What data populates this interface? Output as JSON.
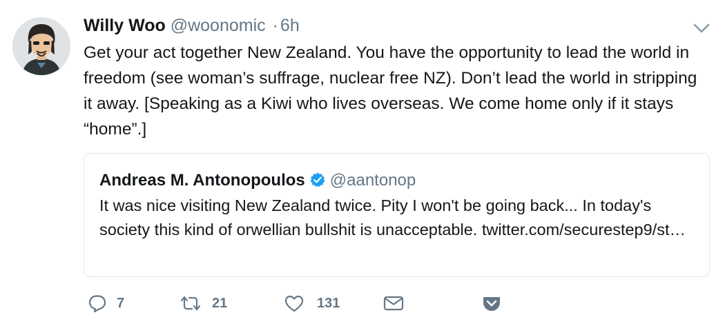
{
  "tweet": {
    "author_name": "Willy Woo",
    "author_handle": "@woonomic",
    "separator": "·",
    "time": "6h",
    "text": "Get your act together New Zealand. You have the opportunity to lead the world in freedom (see woman’s suffrage, nuclear free NZ). Don’t lead the world in stripping it away. [Speaking as a Kiwi who lives overseas. We come home only if it stays “home”.]"
  },
  "quoted_tweet": {
    "author_name": "Andreas M. Antonopoulos",
    "author_handle": "@aantonop",
    "verified": true,
    "text": "It was nice visiting New Zealand twice. Pity I won't be going back... In today's society this kind of orwellian bullshit is unacceptable. twitter.com/securestep9/st…"
  },
  "actions": {
    "reply_count": "7",
    "retweet_count": "21",
    "like_count": "131"
  },
  "colors": {
    "text": "#14171a",
    "secondary": "#657786",
    "border": "#e1e8ed",
    "verified": "#1da1f2"
  },
  "icons": [
    "avatar",
    "chevron-down-icon",
    "verified-badge-icon",
    "reply-icon",
    "retweet-icon",
    "like-icon",
    "message-icon",
    "pocket-icon"
  ]
}
